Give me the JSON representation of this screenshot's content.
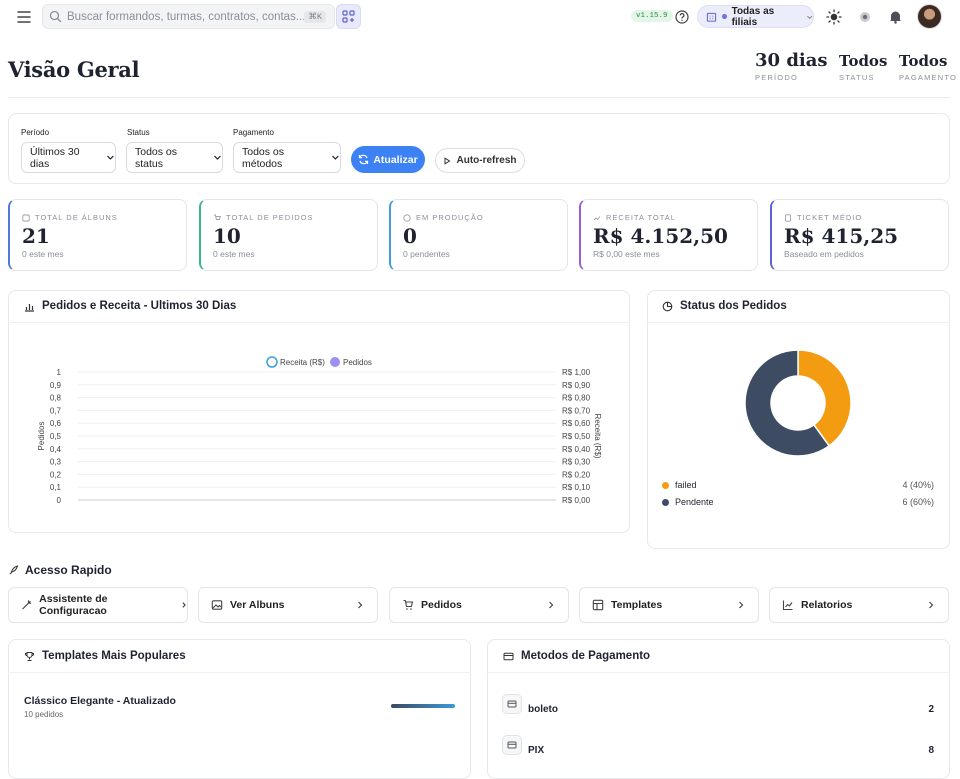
{
  "topbar": {
    "search_placeholder": "Buscar formandos, turmas, contratos, contas...",
    "search_shortcut": "⌘K",
    "version": "v1.15.9",
    "branch_label": "Todas as filiais"
  },
  "header": {
    "title": "Visão Geral",
    "stats": [
      {
        "value": "30 dias",
        "label": "Período"
      },
      {
        "value": "Todos",
        "label": "Status"
      },
      {
        "value": "Todos",
        "label": "Pagamento"
      }
    ]
  },
  "filters": {
    "period": {
      "label": "Período",
      "value": "Últimos 30 dias"
    },
    "status": {
      "label": "Status",
      "value": "Todos os status"
    },
    "payment": {
      "label": "Pagamento",
      "value": "Todos os métodos"
    },
    "refresh_label": "Atualizar",
    "autorefresh_label": "Auto-refresh"
  },
  "stats": [
    {
      "label": "TOTAL DE ÁLBUNS",
      "value": "21",
      "sub": "0 este mes",
      "color": "#4f7bd8"
    },
    {
      "label": "TOTAL DE PEDIDOS",
      "value": "10",
      "sub": "0 este mes",
      "color": "#3bb58b"
    },
    {
      "label": "EM PRODUÇÃO",
      "value": "0",
      "sub": "0 pendentes",
      "color": "#3ea0d3"
    },
    {
      "label": "RECEITA TOTAL",
      "value": "R$ 4.152,50",
      "sub": "R$ 0,00 este mes",
      "color": "#9b5cd6"
    },
    {
      "label": "TICKET MÉDIO",
      "value": "R$ 415,25",
      "sub": "Baseado em pedidos",
      "color": "#5d63d9"
    }
  ],
  "orders_chart": {
    "title": "Pedidos e Receita - Ultimos 30 Dias"
  },
  "chart_data": [
    {
      "type": "line",
      "title": "Pedidos e Receita - Ultimos 30 Dias",
      "series": [
        {
          "name": "Receita (R$)",
          "values": []
        },
        {
          "name": "Pedidos",
          "values": []
        }
      ],
      "ylabel": "Pedidos",
      "y2label": "Receita (R$)",
      "ylim": [
        0,
        1
      ],
      "y2lim": [
        0,
        1
      ],
      "yticks": [
        "0",
        "0,1",
        "0,2",
        "0,3",
        "0,4",
        "0,5",
        "0,6",
        "0,7",
        "0,8",
        "0,9",
        "1"
      ],
      "y2ticks": [
        "R$ 0,00",
        "R$ 0,10",
        "R$ 0,20",
        "R$ 0,30",
        "R$ 0,40",
        "R$ 0,50",
        "R$ 0,60",
        "R$ 0,70",
        "R$ 0,80",
        "R$ 0,90",
        "R$ 1,00"
      ],
      "legend": "top",
      "grid": true,
      "colors": {
        "receita": "#3ea0d3",
        "pedidos": "#9b8ff0"
      }
    },
    {
      "type": "pie",
      "title": "Status dos Pedidos",
      "categories": [
        "failed",
        "Pendente"
      ],
      "values": [
        4,
        6
      ],
      "labels": [
        "4 (40%)",
        "6 (60%)"
      ],
      "colors": [
        "#f39c12",
        "#3d4b63"
      ]
    }
  ],
  "status_chart": {
    "title": "Status dos Pedidos"
  },
  "quick_access": {
    "title": "Acesso Rapido",
    "items": [
      {
        "label": "Assistente de Configuracao"
      },
      {
        "label": "Ver Albuns"
      },
      {
        "label": "Pedidos"
      },
      {
        "label": "Templates"
      },
      {
        "label": "Relatorios"
      }
    ]
  },
  "templates": {
    "title": "Templates Mais Populares",
    "items": [
      {
        "name": "Clássico Elegante - Atualizado",
        "sub": "10 pedidos",
        "fraction": 1.0
      }
    ]
  },
  "payments": {
    "title": "Metodos de Pagamento",
    "items": [
      {
        "name": "boleto",
        "count": "2"
      },
      {
        "name": "PIX",
        "count": "8"
      }
    ]
  }
}
